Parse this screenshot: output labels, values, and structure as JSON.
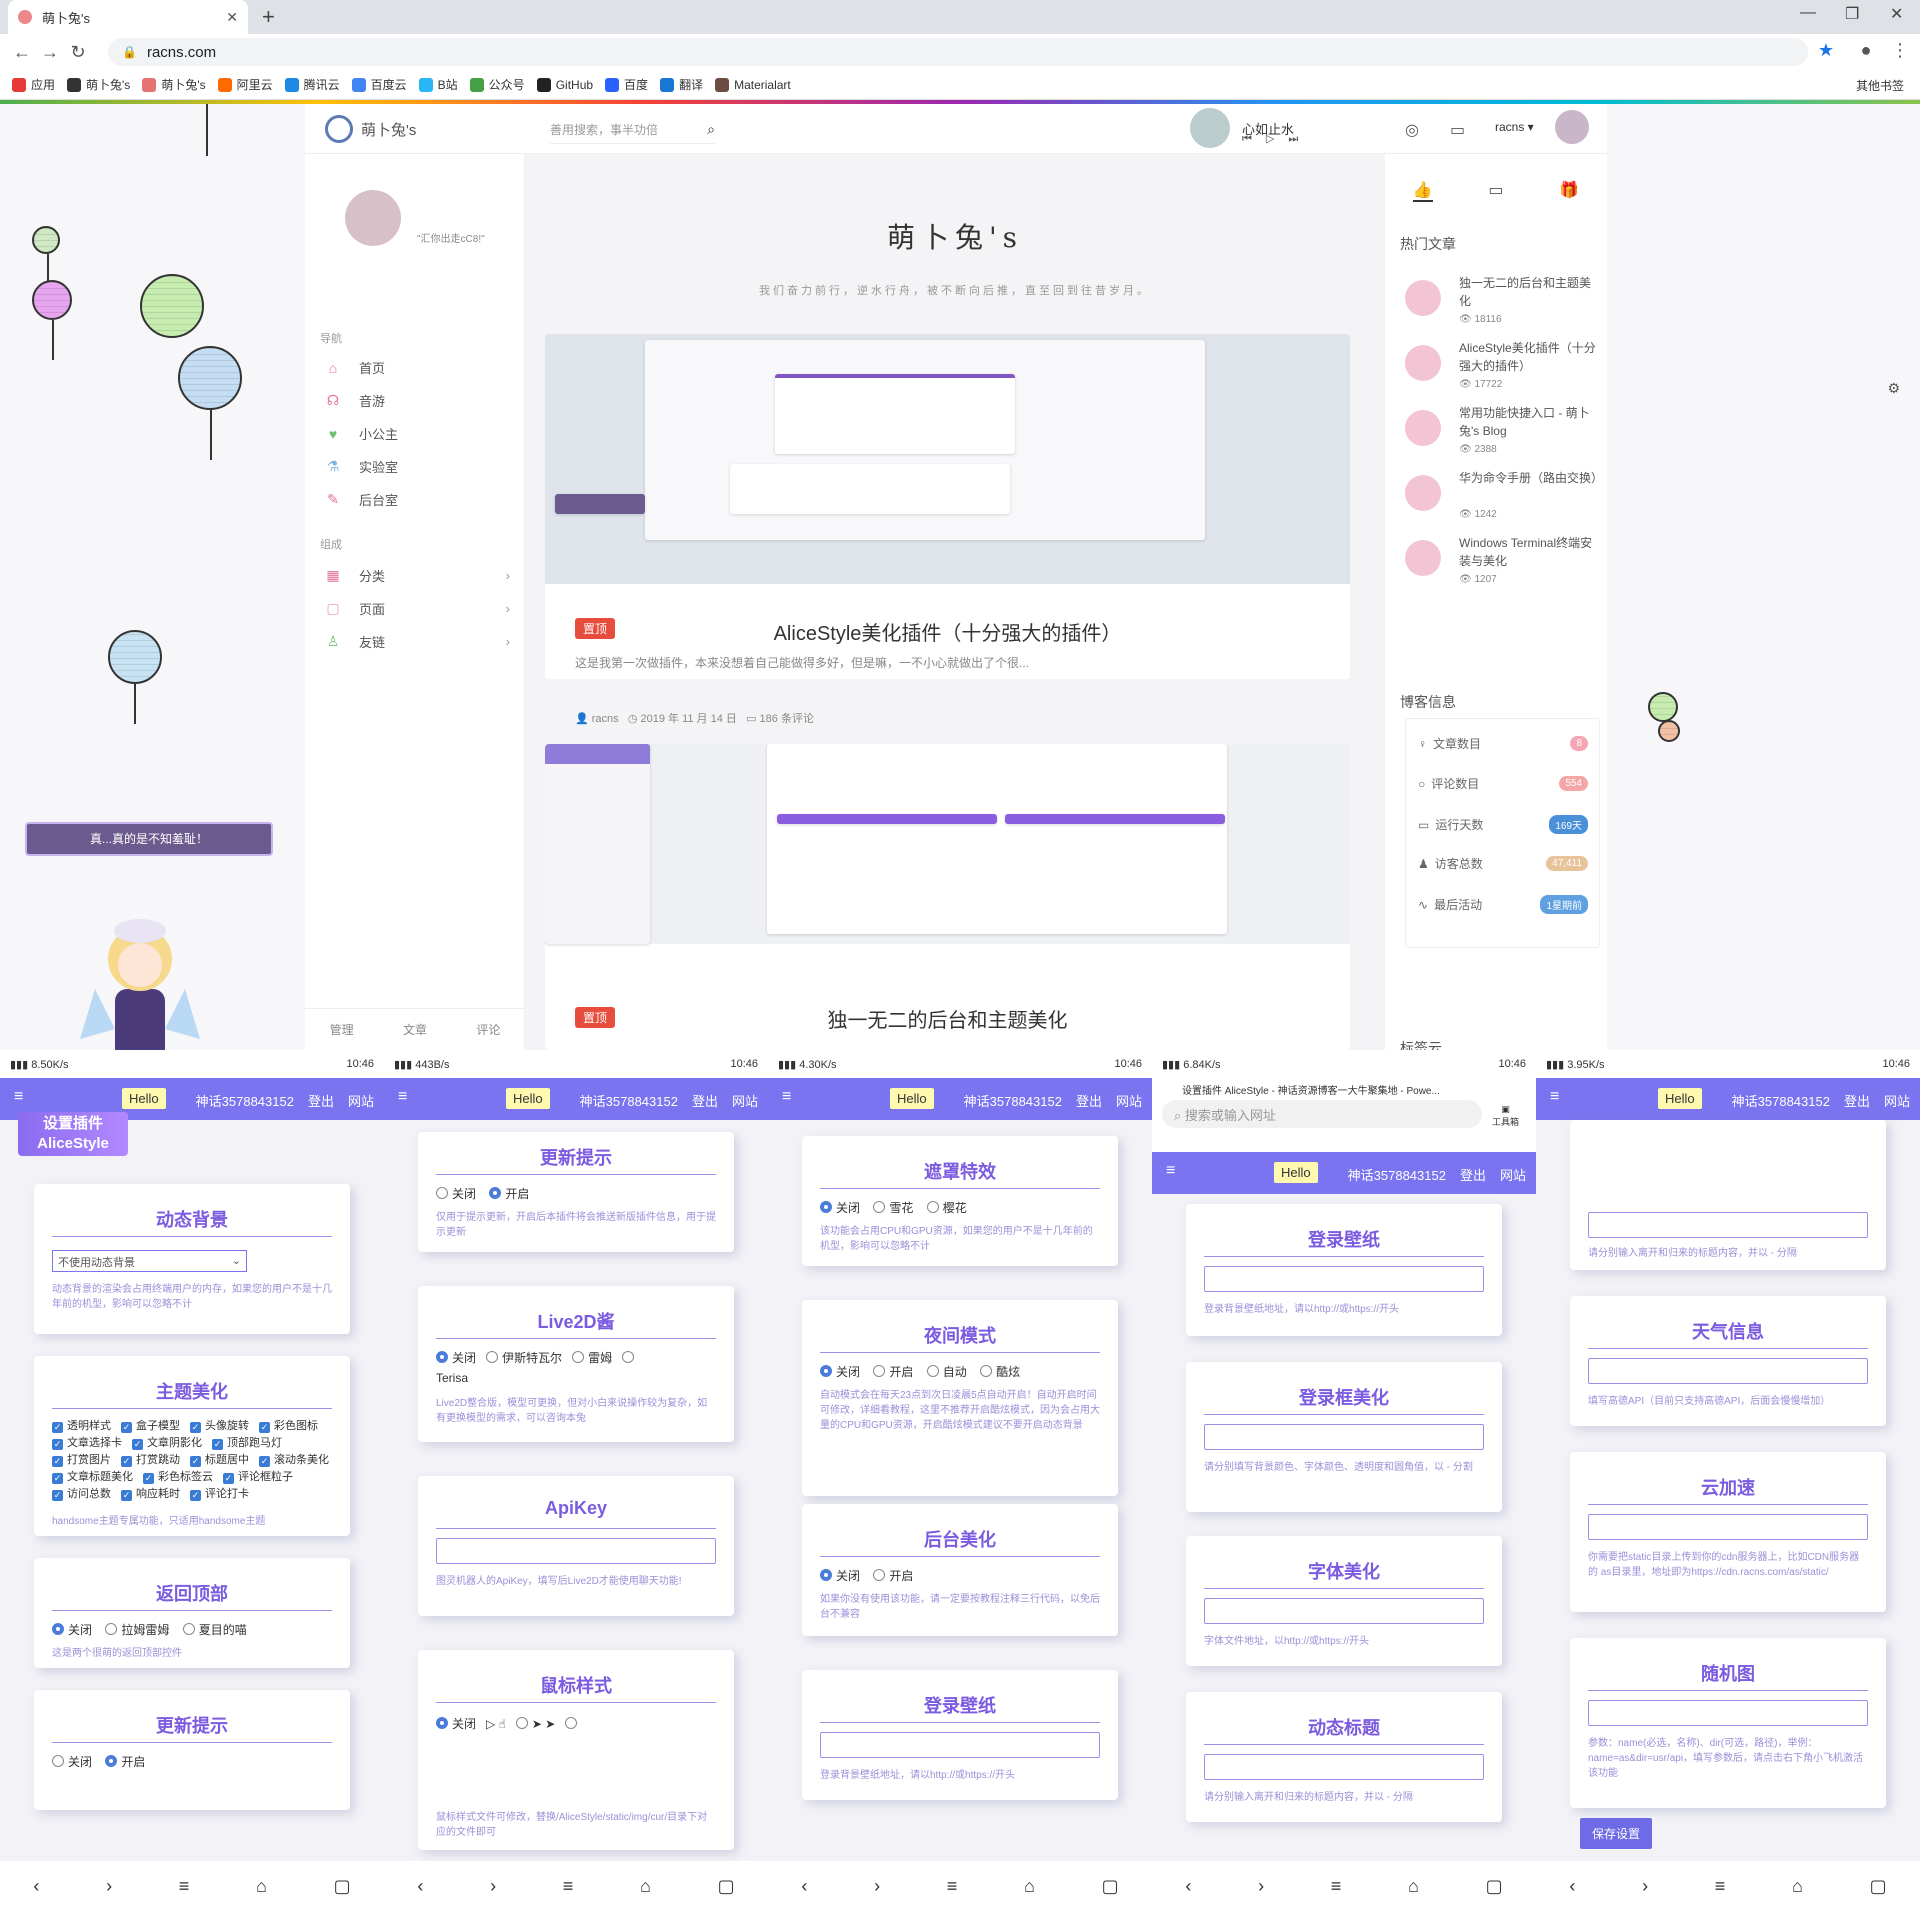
{
  "browser": {
    "tab_title": "萌卜兔's",
    "url": "racns.com",
    "bookmarks": [
      {
        "label": "应用",
        "color": "#e53935"
      },
      {
        "label": "萌卜兔's",
        "color": "#333333"
      },
      {
        "label": "萌卜兔's",
        "color": "#e57373"
      },
      {
        "label": "阿里云",
        "color": "#ff6a00"
      },
      {
        "label": "腾讯云",
        "color": "#1e88e5"
      },
      {
        "label": "百度云",
        "color": "#4285f4"
      },
      {
        "label": "B站",
        "color": "#29b6f6"
      },
      {
        "label": "公众号",
        "color": "#43a047"
      },
      {
        "label": "GitHub",
        "color": "#222222"
      },
      {
        "label": "百度",
        "color": "#2962ff"
      },
      {
        "label": "翻译",
        "color": "#1976d2"
      },
      {
        "label": "Materialart",
        "color": "#6d4c41"
      }
    ],
    "other_bookmarks": "其他书签"
  },
  "site": {
    "search_placeholder": "善用搜索，事半功倍",
    "music_title": "心如止水",
    "username": "racns ▾",
    "profile_text": "\"汇你出走cC8!\"",
    "nav_header": "导航",
    "nav": [
      "首页",
      "音游",
      "小公主",
      "实验室",
      "后台室"
    ],
    "group_header": "组成",
    "groups": [
      "分类",
      "页面",
      "友链"
    ],
    "footer_tabs": [
      "管理",
      "文章",
      "评论"
    ],
    "blog_title": "萌卜兔's",
    "blog_subtitle": "我们奋力前行，逆水行舟，被不断向后推，直至回到往昔岁月。",
    "posts": [
      {
        "badge": "置顶",
        "title": "AliceStyle美化插件（十分强大的插件）",
        "excerpt": "这是我第一次做插件，本来没想着自己能做得多好，但是嘛，一不小心就做出了个很...",
        "author": "racns",
        "date": "2019 年 11 月 14 日",
        "comments": "186 条评论"
      },
      {
        "badge": "置顶",
        "title": "独一无二的后台和主题美化"
      }
    ],
    "hot_header": "热门文章",
    "hot": [
      {
        "title": "独一无二的后台和主题美化",
        "views": "18116"
      },
      {
        "title": "AliceStyle美化插件（十分强大的插件）",
        "views": "17722"
      },
      {
        "title": "常用功能快捷入口 - 萌卜兔's Blog",
        "views": "2388"
      },
      {
        "title": "华为命令手册（路由交换）",
        "views": "1242"
      },
      {
        "title": "Windows Terminal终端安装与美化",
        "views": "1207"
      }
    ],
    "info_header": "博客信息",
    "info": [
      {
        "label": "文章数目",
        "value": "8",
        "color": "#f4a6b5"
      },
      {
        "label": "评论数目",
        "value": "554",
        "color": "#f4a6a6"
      },
      {
        "label": "运行天数",
        "value": "169天",
        "color": "#4a90d9"
      },
      {
        "label": "访客总数",
        "value": "47,411",
        "color": "#e8c39a"
      },
      {
        "label": "最后活动",
        "value": "1星期前",
        "color": "#5fa0e0"
      }
    ],
    "tag_header": "标签云",
    "mascot_tip": "真...真的是不知羞耻！"
  },
  "phones": [
    {
      "status_speed": "8.50K/s",
      "time": "10:46"
    },
    {
      "status_speed": "443B/s",
      "time": "10:46"
    },
    {
      "status_speed": "4.30K/s",
      "time": "10:46"
    },
    {
      "status_speed": "6.84K/s",
      "time": "10:46",
      "page_title": "设置插件 AliceStyle - 神话资源博客一大牛聚集地 - Powe...",
      "search_placeholder": "搜索或输入网址",
      "toolbox": "工具箱"
    },
    {
      "status_speed": "3.95K/s",
      "time": "10:46"
    }
  ],
  "phone_nav": {
    "hello": "Hello",
    "user": "神话3578843152",
    "logout": "登出",
    "site": "网站"
  },
  "p1": {
    "banner": "设置插件\nAliceStyle",
    "bg_title": "动态背景",
    "bg_select": "不使用动态背景",
    "bg_desc": "动态背景的渲染会占用终端用户的内存，如果您的用户不是十几年前的机型，影响可以忽略不计",
    "theme_title": "主题美化",
    "theme_opts": [
      "透明样式",
      "盒子模型",
      "头像旋转",
      "彩色图标",
      "文章选择卡",
      "文章阴影化",
      "顶部跑马灯",
      "打赏图片",
      "打赏跳动",
      "标题居中",
      "滚动条美化",
      "文章标题美化",
      "彩色标签云",
      "评论框粒子",
      "访问总数",
      "响应耗时",
      "评论打卡"
    ],
    "theme_desc": "handsome主题专属功能，只适用handsome主题",
    "top_title": "返回顶部",
    "top_opts": [
      "关闭",
      "拉姆雷姆",
      "夏目的喵"
    ],
    "top_desc": "这是两个很萌的返回顶部控件",
    "update_title": "更新提示",
    "update_opts": [
      "关闭",
      "开启"
    ]
  },
  "p2": {
    "update_title": "更新提示",
    "update_opts": [
      "关闭",
      "开启"
    ],
    "update_desc": "仅用于提示更新，开启后本插件将会推送新版插件信息，用于提示更新",
    "l2d_title": "Live2D酱",
    "l2d_opts": [
      "关闭",
      "伊斯特瓦尔",
      "雷姆",
      "Terisa"
    ],
    "l2d_desc": "Live2D整合版，模型可更换，但对小白来说操作较为复杂，如有更换模型的需求，可以咨询本兔",
    "api_title": "ApiKey",
    "api_desc": "图灵机器人的ApiKey，填写后Live2D才能使用聊天功能!",
    "mouse_title": "鼠标样式",
    "mouse_opts": [
      "关闭"
    ],
    "mouse_desc": "鼠标样式文件可修改，替换/AliceStyle/static/img/cur/目录下对应的文件即可"
  },
  "p3": {
    "mask_title": "遮罩特效",
    "mask_opts": [
      "关闭",
      "雪花",
      "樱花"
    ],
    "mask_desc": "该功能会占用CPU和GPU资源，如果您的用户不是十几年前的机型，影响可以忽略不计",
    "night_title": "夜间模式",
    "night_opts": [
      "关闭",
      "开启",
      "自动",
      "酷炫"
    ],
    "night_desc": "自动模式会在每天23点到次日凌晨5点自动开启！自动开启时间可修改，详细看教程，这里不推荐开启酷炫模式，因为会占用大量的CPU和GPU资源，开启酷炫模式建议不要开启动态背景",
    "admin_title": "后台美化",
    "admin_opts": [
      "关闭",
      "开启"
    ],
    "admin_desc": "如果你没有使用该功能，请一定要按教程注释三行代码，以免后台不兼容",
    "login_title": "登录壁纸",
    "login_desc": "登录背景壁纸地址，请以http://或https://开头"
  },
  "p4": {
    "login_title": "登录壁纸",
    "login_desc": "登录背景壁纸地址，请以http://或https://开头",
    "box_title": "登录框美化",
    "box_desc": "请分别填写背景颜色、字体颜色、透明度和圆角值，以 - 分割",
    "font_title": "字体美化",
    "font_desc": "字体文件地址，以http://或https://开头",
    "dyn_title": "动态标题",
    "dyn_desc": "请分别输入离开和归来的标题内容，并以 - 分隔"
  },
  "p5": {
    "top_desc": "请分别输入离开和归来的标题内容，并以 - 分隔",
    "weather_title": "天气信息",
    "weather_desc": "填写高德API（目前只支持高德API，后面会慢慢增加）",
    "cdn_title": "云加速",
    "cdn_desc": "你需要把static目录上传到你的cdn服务器上，比如CDN服务器的 as目录里，地址即为https://cdn.racns.com/as/static/",
    "rand_title": "随机图",
    "rand_desc": "参数：name(必选，名称)、dir(可选，路径)，举例：name=as&dir=usr/api，填写参数后，请点击右下角小飞机激活该功能",
    "save": "保存设置"
  }
}
